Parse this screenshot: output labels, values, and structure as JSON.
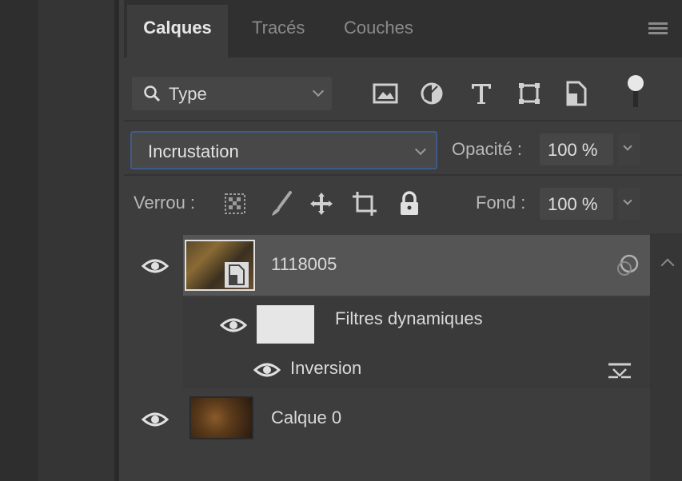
{
  "tabs": [
    {
      "label": "Calques",
      "active": true
    },
    {
      "label": "Tracés",
      "active": false
    },
    {
      "label": "Couches",
      "active": false
    }
  ],
  "filter": {
    "kind_label": "Type",
    "icons": [
      "image-filter-icon",
      "adjustment-filter-icon",
      "text-filter-icon",
      "shape-filter-icon",
      "smart-object-filter-icon",
      "filter-toggle-icon"
    ]
  },
  "blend": {
    "mode": "Incrustation",
    "opacity_label": "Opacité :",
    "opacity_value": "100 %"
  },
  "lock": {
    "label": "Verrou :",
    "icons": [
      "lock-transparent-pixels-icon",
      "lock-image-pixels-icon",
      "lock-position-icon",
      "lock-artboard-icon",
      "lock-all-icon"
    ],
    "fill_label": "Fond :",
    "fill_value": "100 %"
  },
  "layers": [
    {
      "name": "1118005",
      "selected": true,
      "type": "smart-object"
    },
    {
      "name": "Filtres dynamiques",
      "type": "smart-filter-mask"
    },
    {
      "name": "Inversion",
      "type": "smart-filter"
    },
    {
      "name": "Calque 0",
      "selected": false,
      "type": "pixel"
    }
  ],
  "colors": {
    "panel_bg": "#3d3d3d",
    "selected_layer_bg": "#555555",
    "focus_border": "#3e5b8a"
  }
}
